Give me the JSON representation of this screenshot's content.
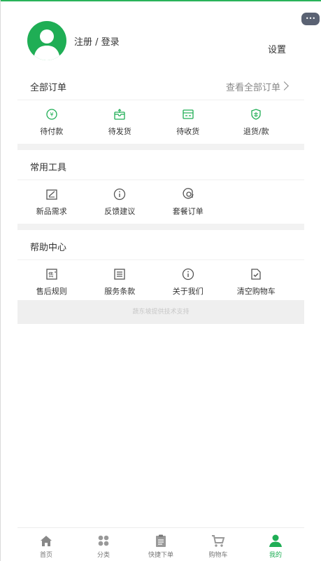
{
  "profile": {
    "login_label": "注册 / 登录",
    "settings_label": "设置"
  },
  "orders": {
    "title": "全部订单",
    "more_label": "查看全部订单",
    "items": [
      {
        "label": "待付款",
        "icon": "payment-pending-icon"
      },
      {
        "label": "待发货",
        "icon": "package-outbox-icon"
      },
      {
        "label": "待收货",
        "icon": "delivery-truck-icon"
      },
      {
        "label": "退货/款",
        "icon": "refund-shield-icon"
      }
    ]
  },
  "tools": {
    "title": "常用工具",
    "items": [
      {
        "label": "新品需求",
        "icon": "edit-note-icon"
      },
      {
        "label": "反馈建议",
        "icon": "info-circle-icon"
      },
      {
        "label": "套餐订单",
        "icon": "target-circle-icon"
      }
    ]
  },
  "help": {
    "title": "帮助中心",
    "items": [
      {
        "label": "售后规则",
        "icon": "after-sales-icon"
      },
      {
        "label": "服务条款",
        "icon": "terms-list-icon"
      },
      {
        "label": "关于我们",
        "icon": "info-circle-icon"
      },
      {
        "label": "清空购物车",
        "icon": "clear-cart-icon"
      }
    ]
  },
  "footer_text": "蔬东坡提供技术支持",
  "tabbar": {
    "items": [
      {
        "label": "首页",
        "icon": "home-icon"
      },
      {
        "label": "分类",
        "icon": "category-grid-icon"
      },
      {
        "label": "快捷下单",
        "icon": "clipboard-icon"
      },
      {
        "label": "购物车",
        "icon": "cart-icon"
      },
      {
        "label": "我的",
        "icon": "user-icon"
      }
    ],
    "active_index": 4
  },
  "colors": {
    "accent": "#1fae55",
    "icon_gray": "#555555",
    "divider": "#f2f2f2"
  }
}
